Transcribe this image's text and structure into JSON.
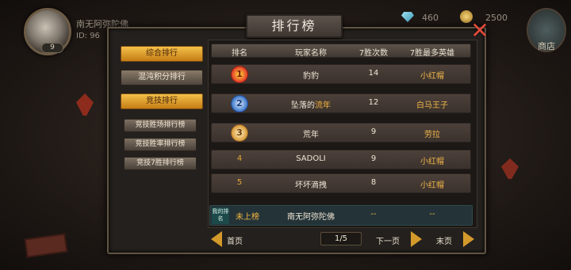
{
  "hud": {
    "player_name": "南无阿弥陀佛",
    "player_id": "ID: 96",
    "level": "9",
    "gem_count": "460",
    "coin_count": "2500",
    "shop_label": "商店"
  },
  "panel": {
    "title": "排行榜",
    "tabs": [
      {
        "label": "综合排行",
        "active": true
      },
      {
        "label": "混沌积分排行",
        "active": false
      },
      {
        "label": "竞技排行",
        "active": true
      }
    ],
    "sub_tabs": [
      {
        "label": "竞技胜场排行榜"
      },
      {
        "label": "竞技胜率排行榜"
      },
      {
        "label": "竞技7胜排行榜"
      }
    ]
  },
  "table": {
    "headers": [
      "排名",
      "玩家名称",
      "7胜次数",
      "7胜最多英雄"
    ],
    "rows": [
      {
        "rank": "1",
        "medal": "gold",
        "name": "豹豹",
        "wins": "14",
        "hero": "小红帽"
      },
      {
        "rank": "2",
        "medal": "silver",
        "name_prefix": "坠落的",
        "name_hl": "流年",
        "wins": "12",
        "hero": "白马王子"
      },
      {
        "rank": "3",
        "medal": "bronze",
        "name": "荒年",
        "wins": "9",
        "hero": "劳拉"
      },
      {
        "rank": "4",
        "name": "SADOLI",
        "wins": "9",
        "hero": "小红帽"
      },
      {
        "rank": "5",
        "name": "坏坏滴拽",
        "wins": "8",
        "hero": "小红帽"
      }
    ]
  },
  "my_rank": {
    "tag": "我的排名",
    "rank": "未上榜",
    "name": "南无阿弥陀佛",
    "wins": "--",
    "hero": "--"
  },
  "pagination": {
    "first": "首页",
    "page": "1/5",
    "next": "下一页",
    "last": "末页"
  },
  "colors": {
    "accent": "#f1b13e",
    "tab_active": "#e3a32a",
    "close": "#e04a3a"
  }
}
